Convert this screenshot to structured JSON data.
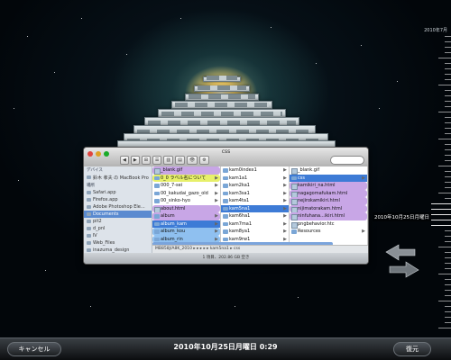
{
  "finder": {
    "window_title": "css",
    "stack_title": "blank.gif",
    "toolbar_buttons": [
      "◀",
      "▶",
      "⊞",
      "☰",
      "▥",
      "▤",
      "👁",
      "⚙"
    ],
    "sidebar": {
      "devices_header": "デバイス",
      "devices": [
        "鈴木 孝夫 の MacBook Pro"
      ],
      "places_header": "場所",
      "places": [
        "Safari.app",
        "Firefox.app",
        "Adobe Photoshop Ele...",
        "Documents",
        "pit2",
        "d_pnl",
        "Ⅳ",
        "Web_Files",
        "inazuma_design"
      ],
      "selected_place": "Documents"
    },
    "column1": [
      {
        "name": "_blank.gif",
        "label": "purple",
        "kind": "file"
      },
      {
        "name": "0_0 ラベル名について",
        "label": "yellow",
        "kind": "folder"
      },
      {
        "name": "000_7-sei",
        "label": "",
        "kind": "folder"
      },
      {
        "name": "00_kakudai_gazo_old",
        "label": "",
        "kind": "folder"
      },
      {
        "name": "00_sinko-hyo",
        "label": "",
        "kind": "folder"
      },
      {
        "name": "about.html",
        "label": "purple",
        "kind": "file"
      },
      {
        "name": "album",
        "label": "purple",
        "kind": "folder"
      },
      {
        "name": "album_kam",
        "label": "selected",
        "kind": "folder"
      },
      {
        "name": "album_kou",
        "label": "blue",
        "kind": "folder"
      },
      {
        "name": "album_rin",
        "label": "blue",
        "kind": "folder"
      }
    ],
    "column2": [
      {
        "name": "kam0index1",
        "label": ""
      },
      {
        "name": "kam1a1",
        "label": ""
      },
      {
        "name": "kam2ka1",
        "label": ""
      },
      {
        "name": "kam3sa1",
        "label": ""
      },
      {
        "name": "kam4ta1",
        "label": ""
      },
      {
        "name": "kam5na1",
        "label": "selected"
      },
      {
        "name": "kam6ha1",
        "label": ""
      },
      {
        "name": "kam7ma1",
        "label": ""
      },
      {
        "name": "kam8ya1",
        "label": ""
      },
      {
        "name": "kam9rw1",
        "label": ""
      }
    ],
    "column3": [
      {
        "name": "_blank.gif",
        "label": ""
      },
      {
        "name": "css",
        "label": "selected"
      },
      {
        "name": "kamikiri_na.html",
        "label": "purple"
      },
      {
        "name": "nagagomafukam.html",
        "label": "purple"
      },
      {
        "name": "nejirokamikiri.html",
        "label": "purple"
      },
      {
        "name": "nijimatorakam.html",
        "label": "purple"
      },
      {
        "name": "ninfuhana...ikiri.html",
        "label": "purple"
      },
      {
        "name": "pngbehavior.htc",
        "label": ""
      },
      {
        "name": "Resources",
        "label": ""
      }
    ],
    "path": "MB858J/A8K_2010 ▸ ▸ ▸ ▸ ▸ kam5na1 ▸ css",
    "status": "1 項目、202.86 GB 空き"
  },
  "timeline": {
    "top_label": "2010年7月",
    "current_label": "2010年10月25日月曜日"
  },
  "bottom": {
    "cancel_label": "キャンセル",
    "datetime": "2010年10月25日月曜日 0:29",
    "restore_label": "復元"
  }
}
